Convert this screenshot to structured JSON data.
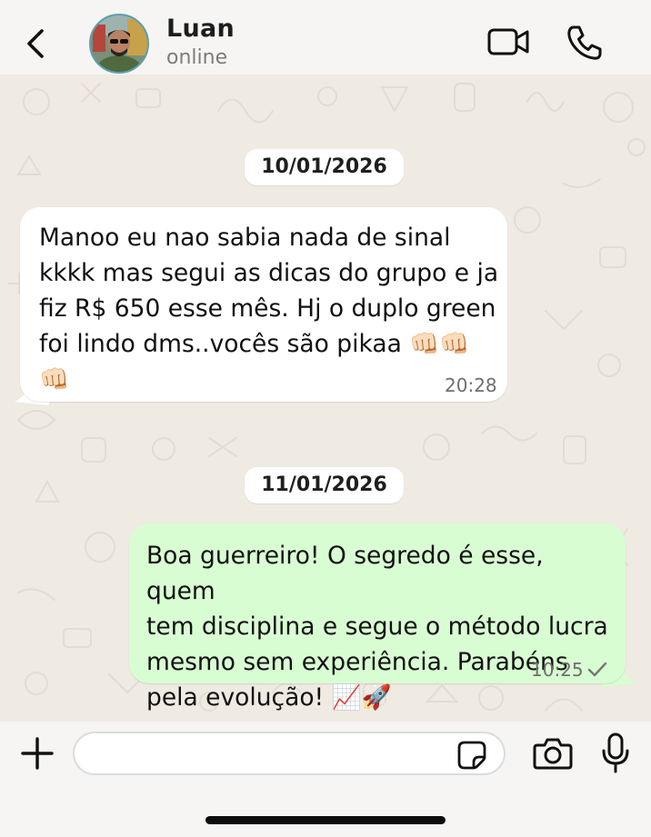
{
  "header": {
    "contact_name": "Luan",
    "contact_status": "online"
  },
  "chat": {
    "messages": [
      {
        "date_label": "10/01/2026",
        "direction": "incoming",
        "text": "Manoo eu nao sabia nada de sinal\nkkkk mas segui as dicas do grupo e ja\nfiz R$ 650 esse mês. Hj o duplo green\nfoi lindo dms..vocês são pikaa 👊🏻👊🏻👊🏻",
        "time": "20:28"
      },
      {
        "date_label": "11/01/2026",
        "direction": "outgoing",
        "text": "Boa guerreiro! O segredo é esse, quem\ntem disciplina e segue o método lucra\nmesmo sem experiência. Parabéns\npela evolução! 📈🚀",
        "time": "10:25",
        "status_icon": "single-check-icon"
      }
    ]
  },
  "composer": {
    "input_value": "",
    "input_placeholder": ""
  },
  "colors": {
    "chat_background": "#efeae2",
    "incoming_bubble": "#ffffff",
    "outgoing_bubble": "#d9fdd3",
    "header_background": "#f6f5f3"
  },
  "icons": {
    "back": "chevron-left-icon",
    "video_call": "video-camera-icon",
    "voice_call": "phone-icon",
    "attach": "plus-icon",
    "sticker": "sticker-icon",
    "camera": "camera-icon",
    "microphone": "microphone-icon"
  }
}
